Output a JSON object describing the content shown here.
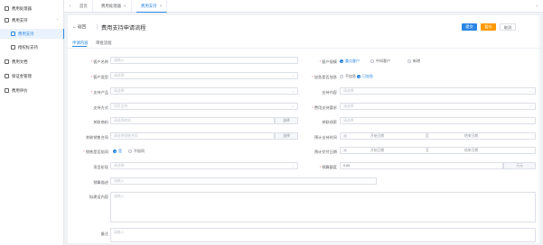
{
  "sidebar": {
    "items": [
      {
        "label": "费用处理器"
      },
      {
        "label": "费用支持"
      },
      {
        "label": "费用支持"
      },
      {
        "label": "授权标支持"
      },
      {
        "label": "费用文档"
      },
      {
        "label": "保证金管理"
      },
      {
        "label": "费用评价"
      }
    ]
  },
  "tabs": [
    {
      "label": "首页"
    },
    {
      "label": "费用处理器"
    },
    {
      "label": "费用支持"
    }
  ],
  "header": {
    "back_label": "返回",
    "title": "费用支持申请流程",
    "submit_label": "提交",
    "save_label": "暂存",
    "cancel_label": "取消"
  },
  "subtabs": [
    {
      "label": "申请内容"
    },
    {
      "label": "审批流程"
    }
  ],
  "form": {
    "customer_name": {
      "label": "客户名称",
      "placeholder": "请输入"
    },
    "customer_size": {
      "label": "客户规模",
      "options": [
        "重点客户",
        "中间客户",
        "新增"
      ]
    },
    "customer_type": {
      "label": "客户类型",
      "placeholder": "请选择"
    },
    "urgent": {
      "label": "加急是否加急",
      "options": [
        "不加急",
        "已加急"
      ]
    },
    "support_product": {
      "label": "支持产品",
      "placeholder": "请选择"
    },
    "support_content": {
      "label": "支持内容",
      "placeholder": "请选择"
    },
    "support_method": {
      "label": "支持方式",
      "placeholder": "项目支持"
    },
    "content_requirement": {
      "label": "费用支持要求",
      "placeholder": "请选择"
    },
    "related_business": {
      "label": "关联商机",
      "placeholder": "请选择商机",
      "addon": "选择"
    },
    "related_clue": {
      "label": "关联线索",
      "placeholder": "请选择"
    },
    "related_order": {
      "label": "关联销售合同",
      "placeholder": "请选择销售合同",
      "addon": "选择"
    },
    "expected_start": {
      "label": "预计支持时间",
      "start": "开始日期",
      "sep": "至",
      "end": "结束日期"
    },
    "need_visit": {
      "label": "销售是否陪同",
      "options": [
        "是",
        "不陪同"
      ]
    },
    "expected_finish": {
      "label": "预计交付日期",
      "start": "开始日期",
      "sep": "至",
      "end": "结束日期"
    },
    "project_stage": {
      "label": "项目阶段",
      "placeholder": "请选择"
    },
    "budget": {
      "label": "预算额度",
      "value": "0.00",
      "unit": "万元"
    },
    "budget_desc": {
      "label": "预算描述",
      "placeholder": "请输入"
    },
    "project_content": {
      "label": "拟建设内容",
      "placeholder": "请输入"
    },
    "remark": {
      "label": "备注",
      "placeholder": "请输入"
    }
  }
}
